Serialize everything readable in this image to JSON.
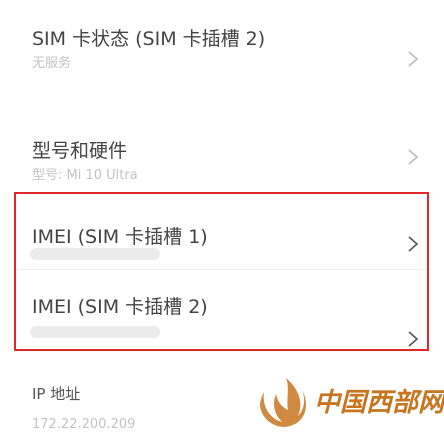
{
  "rows": [
    {
      "title": "SIM 卡状态 (SIM 卡插槽 2)",
      "sub": "无服务"
    },
    {
      "title": "型号和硬件",
      "sub": "型号: Mi 10 Ultra"
    },
    {
      "title": "IMEI (SIM 卡插槽 1)",
      "sub": ""
    },
    {
      "title": "IMEI (SIM 卡插槽 2)",
      "sub": ""
    },
    {
      "title": "IP 地址",
      "sub": "172.22.200.209"
    }
  ],
  "watermark": {
    "text": "中国西部网"
  },
  "colors": {
    "highlight": "#e3262c",
    "title": "#444444",
    "sub": "#c4c4c4",
    "chevron": "#bcbcbc",
    "watermark": "#c8751f"
  },
  "icons": {
    "chevron": "chevron-right-icon",
    "watermark": "flame-logo-icon"
  }
}
